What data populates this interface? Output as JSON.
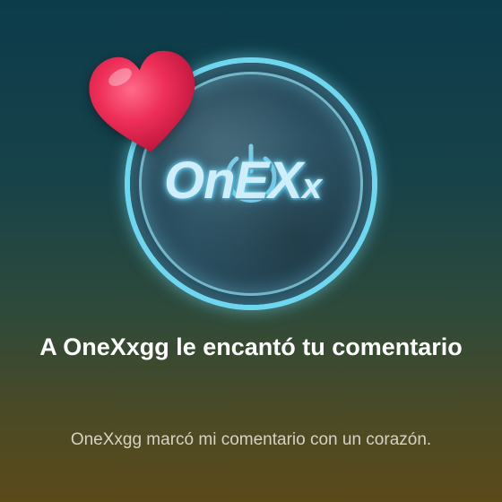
{
  "notification": {
    "title": "A OneXxgg le encantó tu comentario",
    "message": "OneXxgg marcó mi comentario con un corazón."
  },
  "avatar": {
    "logo_main": "OnE",
    "logo_x_big": "X",
    "logo_x_small": "x",
    "ring_color": "#6fd6f0"
  },
  "heart": {
    "icon": "heart-icon",
    "color": "#e8264f"
  }
}
